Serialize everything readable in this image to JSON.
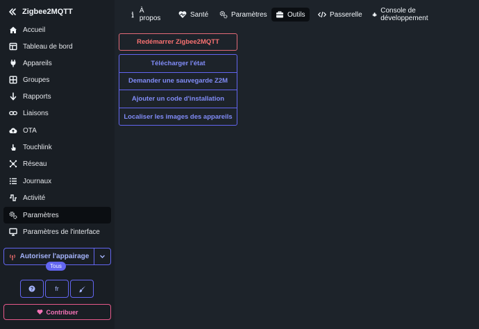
{
  "brand": {
    "title": "Zigbee2MQTT"
  },
  "sidebar": {
    "items": [
      {
        "label": "Accueil",
        "icon": "home-icon"
      },
      {
        "label": "Tableau de bord",
        "icon": "dashboard-icon"
      },
      {
        "label": "Appareils",
        "icon": "plug-icon"
      },
      {
        "label": "Groupes",
        "icon": "grid-icon"
      },
      {
        "label": "Rapports",
        "icon": "arrow-down-icon"
      },
      {
        "label": "Liaisons",
        "icon": "link-icon"
      },
      {
        "label": "OTA",
        "icon": "cloud-upload-icon"
      },
      {
        "label": "Touchlink",
        "icon": "touch-icon"
      },
      {
        "label": "Réseau",
        "icon": "network-icon"
      },
      {
        "label": "Journaux",
        "icon": "list-icon"
      },
      {
        "label": "Activité",
        "icon": "wave-icon"
      },
      {
        "label": "Paramètres",
        "icon": "gears-icon",
        "active": true
      },
      {
        "label": "Paramètres de l'interface",
        "icon": "monitor-icon"
      }
    ],
    "permit_join": {
      "label": "Autoriser l'appairage",
      "target": "Tous"
    },
    "language": "fr",
    "contribute": "Contribuer"
  },
  "tabs": [
    {
      "label": "À propos",
      "icon": "info-icon"
    },
    {
      "label": "Santé",
      "icon": "heart-pulse-icon"
    },
    {
      "label": "Paramètres",
      "icon": "gears-icon"
    },
    {
      "label": "Outils",
      "icon": "toolbox-icon",
      "active": true
    },
    {
      "label": "Passerelle",
      "icon": "code-icon"
    },
    {
      "label": "Console de développement",
      "icon": "bug-icon"
    }
  ],
  "tools": {
    "restart": "Redémarrer Zigbee2MQTT",
    "actions": [
      "Télécharger l'état",
      "Demander une sauvegarde Z2M",
      "Ajouter un code d'installation",
      "Localiser les images des appareils"
    ]
  },
  "colors": {
    "accent": "#6366f1",
    "danger": "#f87171",
    "pink": "#f472b6",
    "background": "#1d232a",
    "sidebar": "#191e24"
  }
}
